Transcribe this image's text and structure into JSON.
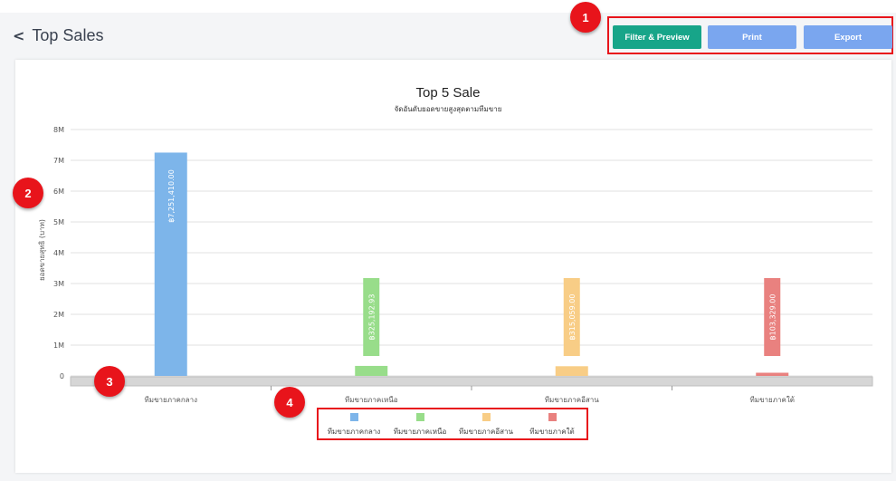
{
  "header": {
    "back_icon": "chevron-left-icon",
    "title": "Top Sales",
    "buttons": {
      "filter": "Filter & Preview",
      "print": "Print",
      "export": "Export"
    }
  },
  "markers": [
    "1",
    "2",
    "3",
    "4"
  ],
  "colors": {
    "filter": "#17a589",
    "print": "#7aa6ef",
    "export": "#7aa6ef",
    "marker": "#e8141b"
  },
  "chart_data": {
    "type": "bar",
    "title": "Top 5 Sale",
    "subtitle": "จัดอันดับยอดขายสูงสุดตามทีมขาย",
    "ylabel": "ยอดขายสุทธิ (บาท)",
    "ylim": [
      0,
      8000000
    ],
    "yticks": [
      "0",
      "1M",
      "2M",
      "3M",
      "4M",
      "5M",
      "6M",
      "7M",
      "8M"
    ],
    "categories": [
      "ทีมขายภาคกลาง",
      "ทีมขายภาคเหนือ",
      "ทีมขายภาคอีสาน",
      "ทีมขายภาคใต้"
    ],
    "values": [
      7251410,
      325192.93,
      315059,
      103329
    ],
    "data_labels": [
      "฿7,251,410.00",
      "฿325,192.93",
      "฿315,059.00",
      "฿103,329.00"
    ],
    "colors": [
      "#7db5ea",
      "#98dd8a",
      "#f8cd86",
      "#e9817f"
    ],
    "grid": true,
    "legend": "bottom"
  }
}
